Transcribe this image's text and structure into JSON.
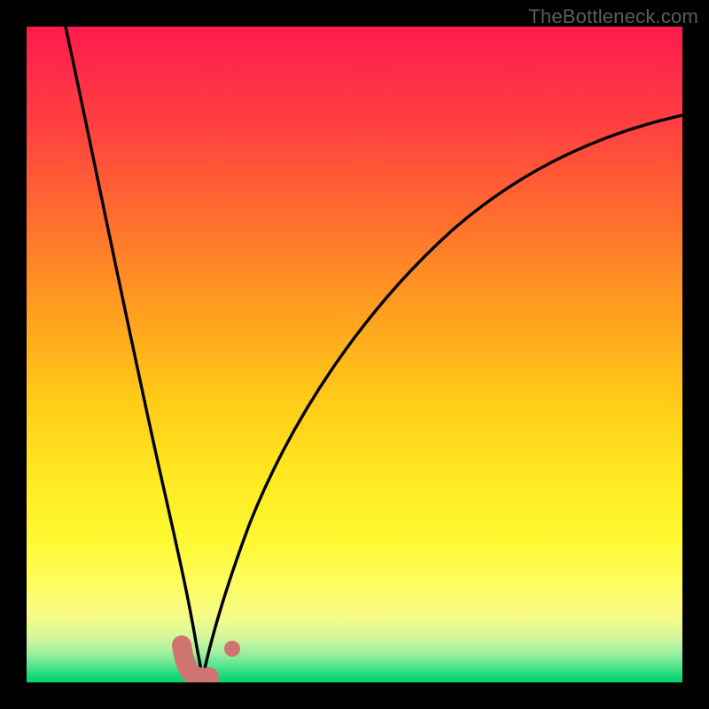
{
  "watermark": {
    "text": "TheBottleneck.com"
  },
  "chart_data": {
    "type": "line",
    "title": "",
    "xlabel": "",
    "ylabel": "",
    "xlim": [
      0,
      100
    ],
    "ylim": [
      0,
      100
    ],
    "grid": false,
    "legend": false,
    "series": [
      {
        "name": "left-branch",
        "x": [
          6,
          8,
          10,
          12,
          14,
          16,
          18,
          20,
          22,
          23,
          24,
          25,
          26
        ],
        "y": [
          100,
          87,
          74,
          62,
          50,
          39,
          29,
          19,
          10,
          6,
          3,
          1,
          0
        ]
      },
      {
        "name": "right-branch",
        "x": [
          26,
          28,
          30,
          33,
          36,
          40,
          45,
          50,
          56,
          63,
          71,
          80,
          90,
          100
        ],
        "y": [
          0,
          5,
          12,
          21,
          30,
          39,
          48,
          55,
          62,
          68,
          74,
          79,
          83,
          86
        ]
      }
    ],
    "markers": [
      {
        "name": "l-shape-left",
        "shape": "round",
        "color": "#cf746f",
        "x": 23.5,
        "y": 5.5,
        "r": 1.7
      },
      {
        "name": "l-shape-mid1",
        "shape": "round",
        "color": "#cf746f",
        "x": 24.0,
        "y": 3.0,
        "r": 1.7
      },
      {
        "name": "l-shape-mid2",
        "shape": "round",
        "color": "#cf746f",
        "x": 25.0,
        "y": 1.2,
        "r": 1.7
      },
      {
        "name": "l-shape-right",
        "shape": "round",
        "color": "#cf746f",
        "x": 27.2,
        "y": 1.2,
        "r": 1.7
      },
      {
        "name": "dot-right",
        "shape": "round",
        "color": "#cf746f",
        "x": 31.0,
        "y": 5.0,
        "r": 1.3
      }
    ],
    "background_gradient": {
      "direction": "vertical",
      "stops": [
        {
          "pos": 0.0,
          "color": "#ff1a4c"
        },
        {
          "pos": 0.4,
          "color": "#ff9a20"
        },
        {
          "pos": 0.68,
          "color": "#ffe820"
        },
        {
          "pos": 0.9,
          "color": "#f7fb85"
        },
        {
          "pos": 1.0,
          "color": "#00d470"
        }
      ]
    }
  }
}
